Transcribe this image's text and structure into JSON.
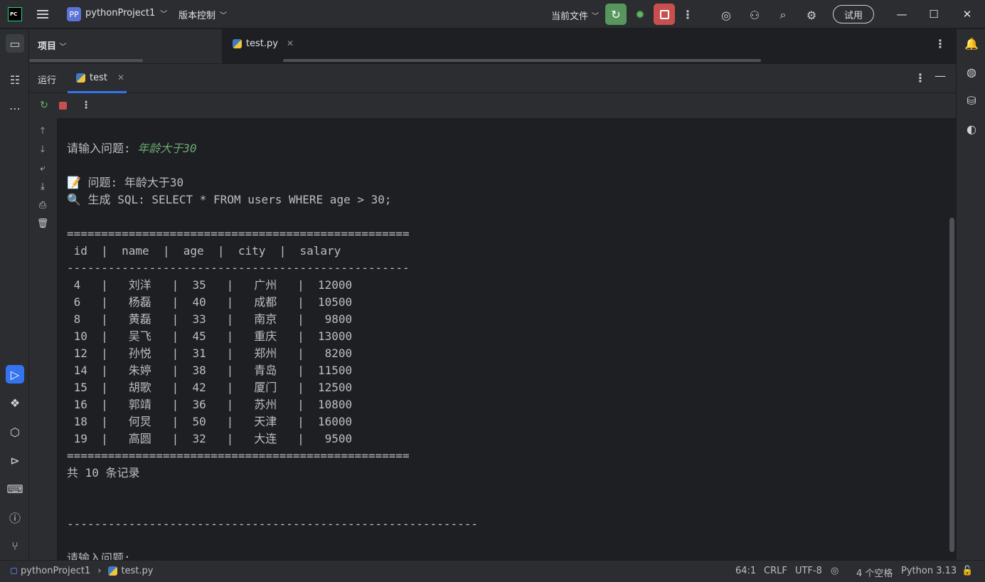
{
  "titlebar": {
    "app_logo": "PC",
    "project_badge": "PP",
    "project_name": "pythonProject1",
    "vcs_label": "版本控制",
    "current_file_label": "当前文件",
    "trial_label": "试用"
  },
  "project_panel": {
    "label": "项目"
  },
  "editor_tabs": [
    {
      "label": "test.py"
    }
  ],
  "run_panel": {
    "title": "运行",
    "tab_label": "test"
  },
  "console": {
    "lines": [
      {
        "text": "请输入问题: ",
        "input": "年龄大于30"
      },
      {
        "text": ""
      },
      {
        "text": "📝 问题: 年龄大于30"
      },
      {
        "text": "🔍 生成 SQL: SELECT * FROM users WHERE age > 30;"
      },
      {
        "text": ""
      },
      {
        "text": "=================================================="
      },
      {
        "text": " id  |  name  |  age  |  city  |  salary"
      },
      {
        "text": "--------------------------------------------------"
      },
      {
        "text": " 4   |   刘洋   |  35   |   广州   |  12000"
      },
      {
        "text": " 6   |   杨磊   |  40   |   成都   |  10500"
      },
      {
        "text": " 8   |   黄磊   |  33   |   南京   |   9800"
      },
      {
        "text": " 10  |   吴飞   |  45   |   重庆   |  13000"
      },
      {
        "text": " 12  |   孙悦   |  31   |   郑州   |   8200"
      },
      {
        "text": " 14  |   朱婷   |  38   |   青岛   |  11500"
      },
      {
        "text": " 15  |   胡歌   |  42   |   厦门   |  12500"
      },
      {
        "text": " 16  |   郭靖   |  36   |   苏州   |  10800"
      },
      {
        "text": " 18  |   何炅   |  50   |   天津   |  16000"
      },
      {
        "text": " 19  |   高圆   |  32   |   大连   |   9500"
      },
      {
        "text": "=================================================="
      },
      {
        "text": "共 10 条记录"
      },
      {
        "text": ""
      },
      {
        "text": ""
      },
      {
        "text": "------------------------------------------------------------"
      },
      {
        "text": ""
      },
      {
        "text": "请输入问题:"
      }
    ]
  },
  "statusbar": {
    "breadcrumb_project": "pythonProject1",
    "breadcrumb_file": "test.py",
    "cursor_position": "64:1",
    "line_separator": "CRLF",
    "encoding": "UTF-8",
    "indent": "4 个空格",
    "interpreter": "Python 3.13"
  },
  "colors": {
    "accent": "#3574f0",
    "run_green": "#57965c",
    "stop_red": "#c94f4f",
    "input_green": "#6aab73"
  }
}
